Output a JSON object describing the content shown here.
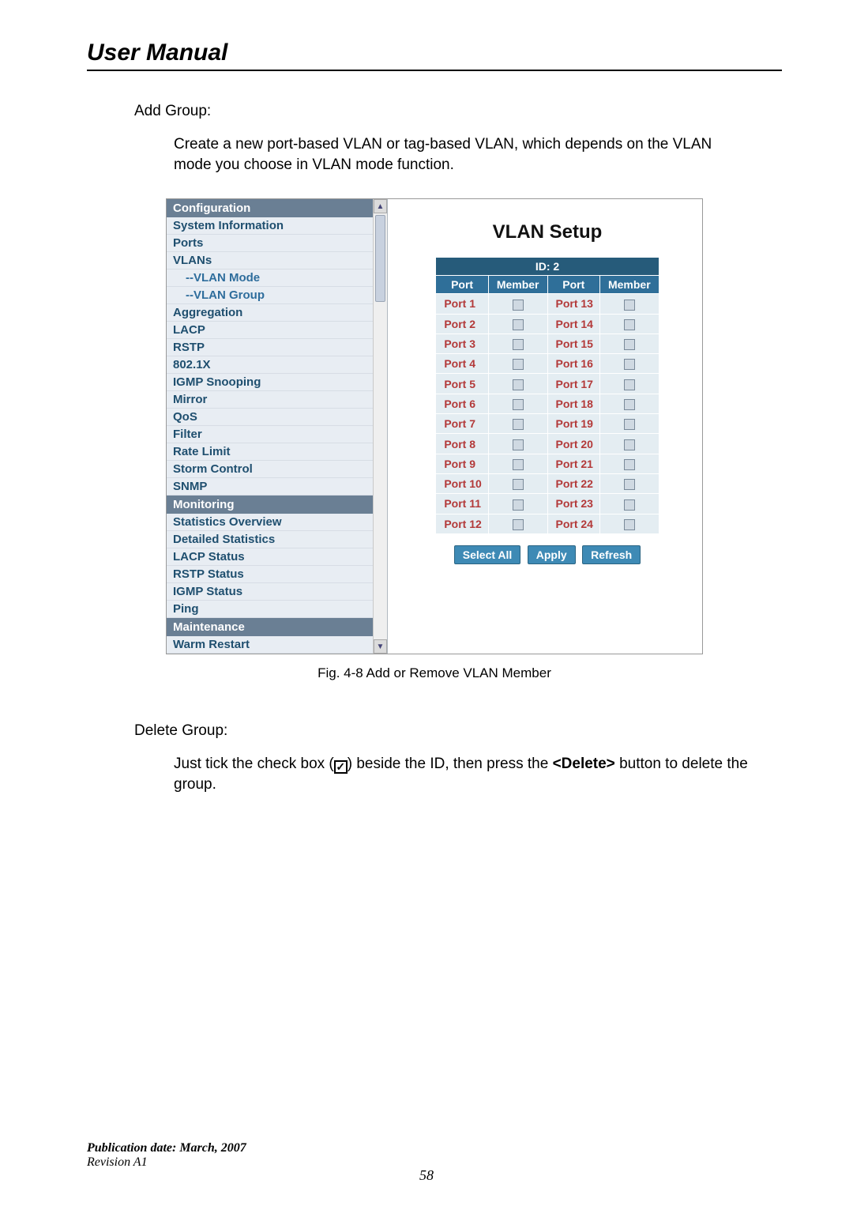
{
  "doc_title": "User Manual",
  "add_group_heading": "Add Group:",
  "add_group_body": "Create a new port-based VLAN or tag-based VLAN, which depends on the VLAN mode you choose in VLAN mode function.",
  "caption": "Fig. 4-8 Add or Remove VLAN Member",
  "delete_group_heading": "Delete Group:",
  "delete_group_body_pre": "Just tick the check box (",
  "delete_group_body_post": ") beside the ID, then press the ",
  "delete_bold": "<Delete>",
  "delete_group_body_end": " button to delete the group.",
  "footer_pub": "Publication date: March, 2007",
  "footer_rev": "Revision A1",
  "page_no": "58",
  "screenshot": {
    "nav": {
      "headers": {
        "configuration": "Configuration",
        "monitoring": "Monitoring",
        "maintenance": "Maintenance"
      },
      "items": [
        "System Information",
        "Ports",
        "VLANs",
        "--VLAN Mode",
        "--VLAN Group",
        "Aggregation",
        "LACP",
        "RSTP",
        "802.1X",
        "IGMP Snooping",
        "Mirror",
        "QoS",
        "Filter",
        "Rate Limit",
        "Storm Control",
        "SNMP"
      ],
      "monitoring_items": [
        "Statistics Overview",
        "Detailed Statistics",
        "LACP Status",
        "RSTP Status",
        "IGMP Status",
        "Ping"
      ],
      "maintenance_items": [
        "Warm Restart"
      ]
    },
    "content": {
      "title": "VLAN Setup",
      "id_label": "ID: 2",
      "col_port": "Port",
      "col_member": "Member",
      "ports_left": [
        "Port 1",
        "Port 2",
        "Port 3",
        "Port 4",
        "Port 5",
        "Port 6",
        "Port 7",
        "Port 8",
        "Port 9",
        "Port 10",
        "Port 11",
        "Port 12"
      ],
      "ports_right": [
        "Port 13",
        "Port 14",
        "Port 15",
        "Port 16",
        "Port 17",
        "Port 18",
        "Port 19",
        "Port 20",
        "Port 21",
        "Port 22",
        "Port 23",
        "Port 24"
      ],
      "btn_select_all": "Select All",
      "btn_apply": "Apply",
      "btn_refresh": "Refresh"
    }
  }
}
